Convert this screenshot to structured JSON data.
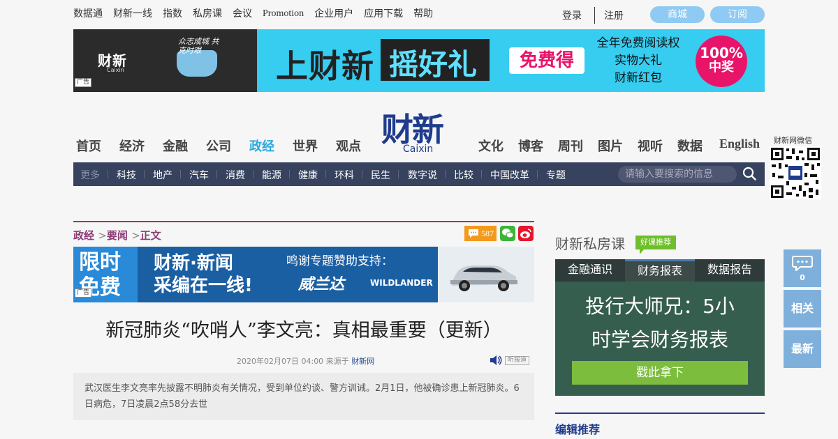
{
  "topbar": {
    "links": [
      "数据通",
      "财新一线",
      "指数",
      "私房课",
      "会议",
      "Promotion",
      "企业用户",
      "应用下载",
      "帮助"
    ],
    "login": "登录",
    "register": "注册",
    "mall": "商城",
    "subscribe": "订阅"
  },
  "banner_ad": {
    "logo": "财新",
    "logo_sub": "Caixin",
    "hand": "众志成城 共克时艰",
    "tag": "广告",
    "t1": "上财新",
    "t2": "摇好礼",
    "free": "免费得",
    "list": [
      "全年免费阅读权",
      "实物大礼",
      "财新红包"
    ],
    "circle_a": "100%",
    "circle_b": "中奖"
  },
  "logo": {
    "cn": "财新",
    "en": "Caixin"
  },
  "main_nav": {
    "left": [
      "首页",
      "经济",
      "金融",
      "公司",
      "政经",
      "世界",
      "观点"
    ],
    "right": [
      "文化",
      "博客",
      "周刊",
      "图片",
      "视听",
      "数据",
      "English"
    ],
    "active": "政经"
  },
  "sub_nav": {
    "items": [
      "更多",
      "科技",
      "地产",
      "汽车",
      "消费",
      "能源",
      "健康",
      "环科",
      "民生",
      "数字说",
      "比较",
      "中国改革",
      "专题"
    ],
    "search_placeholder": "请输入要搜索的信息"
  },
  "qr": {
    "label": "财新网微信"
  },
  "breadcrumb": {
    "section": "政经",
    "sub": "要闻",
    "current": "正文",
    "sep": ">"
  },
  "comments": {
    "count": "587"
  },
  "article_ad": {
    "left": [
      "限时",
      "免费"
    ],
    "mid": [
      "财新·新闻",
      "采编在一线!"
    ],
    "r1": "鸣谢专题赞助支持：",
    "r2": "威兰达",
    "r3": "WILDLANDER",
    "tag": "广告"
  },
  "article": {
    "title": "新冠肺炎“吹哨人”李文亮：真相最重要（更新）",
    "date": "2020年02月07日 04:00",
    "source_prefix": "来源于",
    "source": "财新网",
    "listen": "听报道",
    "summary": "武汉医生李文亮率先披露不明肺炎有关情况，受到单位约谈、警方训诫。2月1日，他被确诊患上新冠肺炎。6日病危，7日凌晨2点58分去世"
  },
  "sidebar": {
    "title": "财新私房课",
    "badge": "好课推荐",
    "tabs": [
      "金融通识",
      "财务报表",
      "数据报告"
    ],
    "active_tab": 1,
    "board_lines": [
      "投行大师兄：5小",
      "时学会财务报表"
    ],
    "cta": "戳此拿下",
    "editor_pick": "编辑推荐"
  },
  "float": {
    "comment_count": "0",
    "related": "相关",
    "latest": "最新"
  },
  "colors": {
    "accent": "#8b3a76",
    "nav_active": "#2ba9e1",
    "subnav_bg": "#36425e",
    "brand_blue": "#1f3b8c"
  }
}
